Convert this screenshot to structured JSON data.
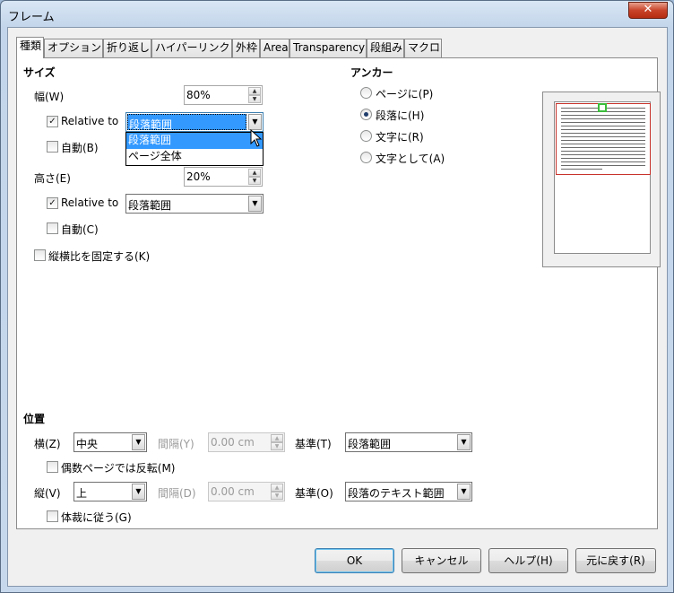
{
  "window": {
    "title": "フレーム",
    "close_symbol": "✕"
  },
  "tabs": [
    {
      "label": "種類",
      "active": true
    },
    {
      "label": "オプション"
    },
    {
      "label": "折り返し"
    },
    {
      "label": "ハイパーリンク"
    },
    {
      "label": "外枠"
    },
    {
      "label": "Area"
    },
    {
      "label": "Transparency"
    },
    {
      "label": "段組み"
    },
    {
      "label": "マクロ"
    }
  ],
  "size": {
    "heading": "サイズ",
    "width_label": "幅(W)",
    "width_value": "80%",
    "width_relative_label": "Relative to",
    "width_relative_checked": true,
    "width_relative_value": "段落範囲",
    "width_dropdown_options": [
      "段落範囲",
      "ページ全体"
    ],
    "width_dropdown_selected": "段落範囲",
    "width_auto_label": "自動(B)",
    "height_label": "高さ(E)",
    "height_value": "20%",
    "height_relative_label": "Relative to",
    "height_relative_checked": true,
    "height_relative_value": "段落範囲",
    "height_auto_label": "自動(C)",
    "keep_ratio_label": "縦横比を固定する(K)"
  },
  "anchor": {
    "heading": "アンカー",
    "options": [
      {
        "label": "ページに(P)",
        "selected": false
      },
      {
        "label": "段落に(H)",
        "selected": true
      },
      {
        "label": "文字に(R)",
        "selected": false
      },
      {
        "label": "文字として(A)",
        "selected": false
      }
    ]
  },
  "position": {
    "heading": "位置",
    "horizontal_label": "横(Z)",
    "horizontal_value": "中央",
    "h_spacing_label": "間隔(Y)",
    "h_spacing_value": "0.00 cm",
    "h_base_label": "基準(T)",
    "h_base_value": "段落範囲",
    "mirror_label": "偶数ページでは反転(M)",
    "vertical_label": "縦(V)",
    "vertical_value": "上",
    "v_spacing_label": "間隔(D)",
    "v_spacing_value": "0.00 cm",
    "v_base_label": "基準(O)",
    "v_base_value": "段落のテキスト範囲",
    "follow_label": "体裁に従う(G)"
  },
  "buttons": {
    "ok": "OK",
    "cancel": "キャンセル",
    "help": "ヘルプ(H)",
    "reset": "元に戻す(R)"
  },
  "icons": {
    "spin_up": "▲",
    "spin_down": "▼",
    "combo_arrow": "▼",
    "checkmark": "✓"
  }
}
